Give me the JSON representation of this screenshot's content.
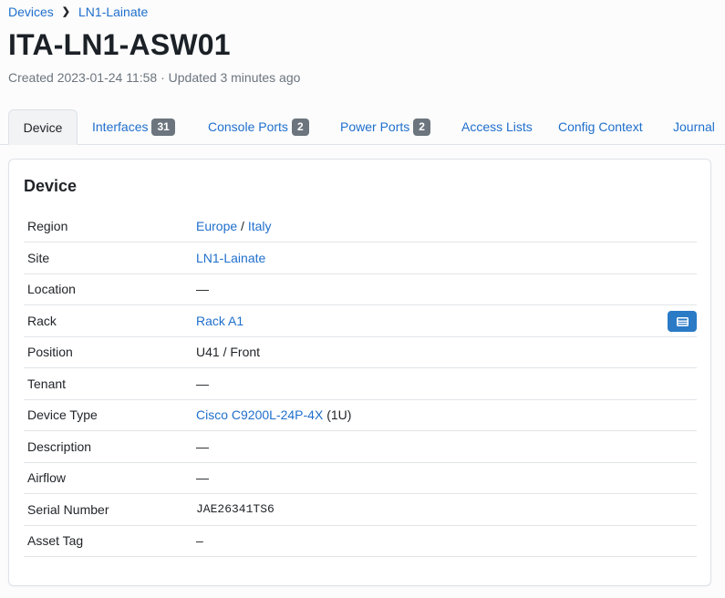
{
  "breadcrumb": {
    "root": "Devices",
    "site": "LN1-Lainate"
  },
  "page": {
    "title": "ITA-LN1-ASW01",
    "meta": "Created 2023-01-24 11:58 · Updated 3 minutes ago"
  },
  "tabs": [
    {
      "label": "Device",
      "active": true
    },
    {
      "label": "Interfaces",
      "count": "31"
    },
    {
      "label": "Console Ports",
      "count": "2"
    },
    {
      "label": "Power Ports",
      "count": "2"
    },
    {
      "label": "Access Lists"
    },
    {
      "label": "Config Context"
    },
    {
      "label": "Journal"
    }
  ],
  "card": {
    "title": "Device",
    "rows": {
      "region": {
        "label": "Region",
        "region": "Europe",
        "sep": "/",
        "sub": "Italy"
      },
      "site": {
        "label": "Site",
        "value": "LN1-Lainate"
      },
      "location": {
        "label": "Location",
        "value": "—"
      },
      "rack": {
        "label": "Rack",
        "value": "Rack A1",
        "button_icon": "rack-icon"
      },
      "position": {
        "label": "Position",
        "value": "U41 / Front"
      },
      "tenant": {
        "label": "Tenant",
        "value": "—"
      },
      "device_type": {
        "label": "Device Type",
        "value": "Cisco C9200L-24P-4X",
        "suffix": "(1U)"
      },
      "description": {
        "label": "Description",
        "value": "—"
      },
      "airflow": {
        "label": "Airflow",
        "value": "—"
      },
      "serial": {
        "label": "Serial Number",
        "value": "JAE26341TS6"
      },
      "asset_tag": {
        "label": "Asset Tag",
        "value": "–"
      }
    }
  },
  "colors": {
    "link": "#1f6fcc",
    "badge": "#6c757d",
    "button": "#2a7ac6"
  }
}
